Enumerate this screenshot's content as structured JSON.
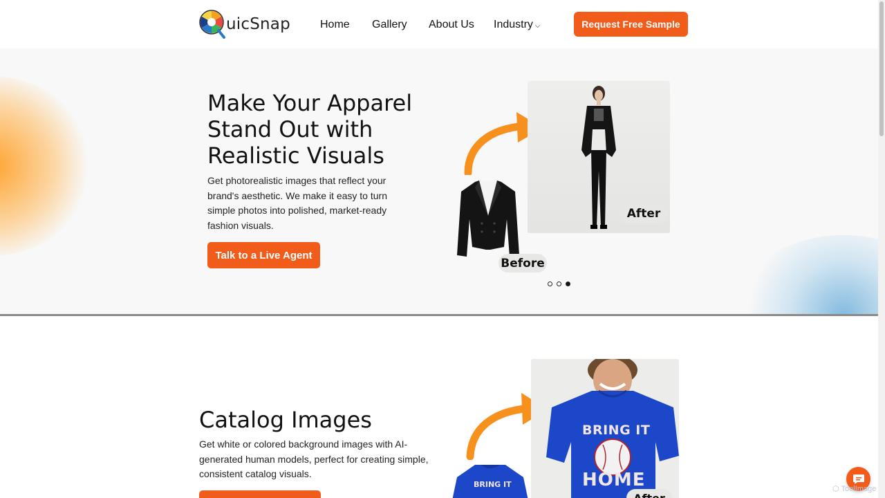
{
  "header": {
    "logo_text": "uicSnap",
    "nav": [
      {
        "label": "Home"
      },
      {
        "label": "Gallery"
      },
      {
        "label": "About Us"
      },
      {
        "label": "Industry"
      }
    ],
    "cta_label": "Request Free Sample"
  },
  "hero": {
    "title_lines": [
      "Make Your Apparel",
      "Stand Out with",
      "Realistic Visuals"
    ],
    "description": "Get photorealistic images that reflect your brand's aesthetic. We make it easy to turn simple photos into polished, market-ready fashion visuals.",
    "button_label": "Talk to a Live Agent",
    "before_label": "Before",
    "after_label": "After",
    "carousel": {
      "total": 3,
      "active": 3
    }
  },
  "catalog": {
    "title": "Catalog Images",
    "description": "Get white or colored background images with AI-generated human models, perfect for creating simple, consistent catalog visuals.",
    "shirt_text_top": "BRING IT",
    "shirt_text_bottom": "HOME",
    "small_shirt_text": "BRING IT",
    "after_label": "After"
  },
  "watermark": "ToolImage",
  "colors": {
    "accent": "#f25c1a",
    "arrow": "#f7911e",
    "shirt": "#1c47c9"
  }
}
